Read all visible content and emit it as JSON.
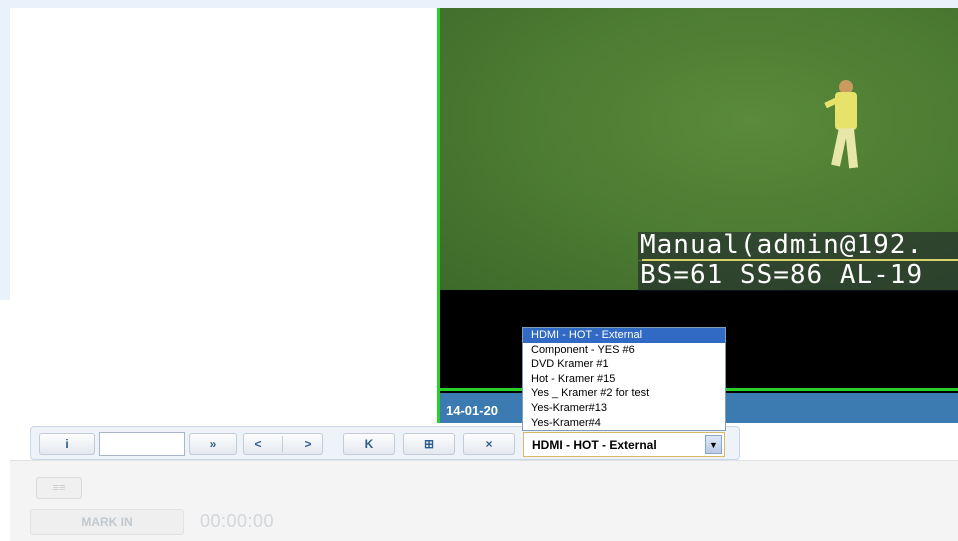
{
  "video": {
    "osd_line1": "Manual(admin@192.",
    "osd_line2": "BS=61 SS=86 AL-19",
    "status_text": "14-01-20"
  },
  "source_dropdown": {
    "selected": "HDMI - HOT - External",
    "options": [
      "HDMI - HOT - External",
      "Component - YES #6",
      "DVD Kramer #1",
      "Hot - Kramer #15",
      "Yes _ Kramer #2 for test",
      "Yes-Kramer#13",
      "Yes-Kramer#4"
    ]
  },
  "toolbar": {
    "info_label": "i",
    "frame_input_value": "",
    "fast_forward_label": "»",
    "prev_label": "<",
    "next_label": ">",
    "to_start_label": "K",
    "grid_label": "⊞",
    "close_label": "×",
    "dropdown_arrow": "▼"
  },
  "bottom": {
    "list_label": "≡≡",
    "mark_in_label": "MARK IN",
    "timecode": "00:00:00"
  },
  "colors": {
    "accent_green": "#27d12a",
    "status_blue": "#3c7bb1",
    "selection_blue": "#316ac5"
  }
}
